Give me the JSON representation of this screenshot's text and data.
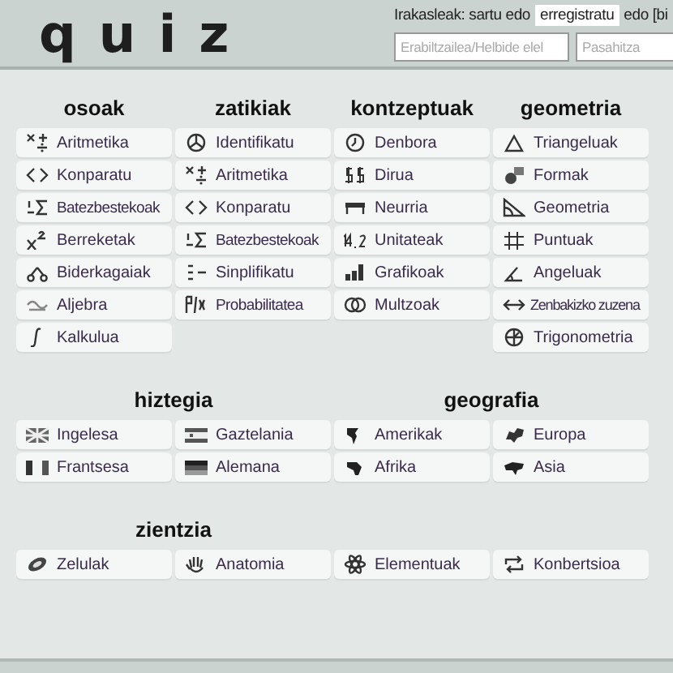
{
  "header": {
    "logo": "quiz",
    "login_prompt": "Irakasleak: sartu edo",
    "register_link": "erregistratu",
    "search_hint": "edo [bi",
    "username": {
      "placeholder": "Erabiltzailea/Helbide elel"
    },
    "password": {
      "placeholder": "Pasahitza"
    }
  },
  "sections": [
    {
      "groups": [
        {
          "title": "osoak",
          "items": [
            {
              "label": "Aritmetika"
            },
            {
              "label": "Konparatu"
            },
            {
              "label": "Batezbestekoak"
            },
            {
              "label": "Berreketak"
            },
            {
              "label": "Biderkagaiak"
            },
            {
              "label": "Aljebra"
            },
            {
              "label": "Kalkulua"
            }
          ]
        },
        {
          "title": "zatikiak",
          "items": [
            {
              "label": "Identifikatu"
            },
            {
              "label": "Aritmetika"
            },
            {
              "label": "Konparatu"
            },
            {
              "label": "Batezbestekoak"
            },
            {
              "label": "Sinplifikatu"
            },
            {
              "label": "Probabilitatea"
            }
          ]
        },
        {
          "title": "kontzeptuak",
          "items": [
            {
              "label": "Denbora"
            },
            {
              "label": "Dirua"
            },
            {
              "label": "Neurria"
            },
            {
              "label": "Unitateak"
            },
            {
              "label": "Grafikoak"
            },
            {
              "label": "Multzoak"
            }
          ]
        },
        {
          "title": "geometria",
          "items": [
            {
              "label": "Triangeluak"
            },
            {
              "label": "Formak"
            },
            {
              "label": "Geometria"
            },
            {
              "label": "Puntuak"
            },
            {
              "label": "Angeluak"
            },
            {
              "label": "Zenbakizko zuzena"
            },
            {
              "label": "Trigonometria"
            }
          ]
        }
      ]
    },
    {
      "groups": [
        {
          "title": "hiztegia",
          "items": [
            {
              "label": "Ingelesa"
            },
            {
              "label": "Gaztelania"
            },
            {
              "label": "Frantsesa"
            },
            {
              "label": "Alemana"
            }
          ]
        },
        {
          "title": "geografia",
          "items": [
            {
              "label": "Amerikak"
            },
            {
              "label": "Europa"
            },
            {
              "label": "Afrika"
            },
            {
              "label": "Asia"
            }
          ]
        }
      ]
    },
    {
      "groups": [
        {
          "title": "zientzia",
          "items": [
            {
              "label": "Zelulak"
            },
            {
              "label": "Anatomia"
            }
          ]
        },
        {
          "items": [
            {
              "label": "Elementuak"
            },
            {
              "label": "Konbertsioa"
            }
          ]
        }
      ]
    }
  ]
}
